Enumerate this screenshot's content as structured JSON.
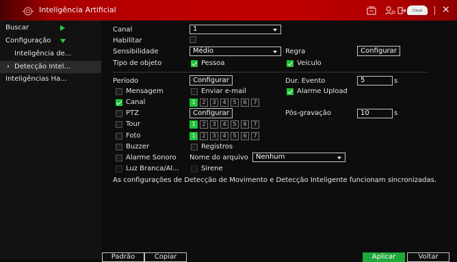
{
  "window": {
    "title": "Inteligência Artificial"
  },
  "titlebar": {
    "cloud_label": "Cloud",
    "close_label": "×"
  },
  "sidebar": {
    "items": [
      {
        "label": "Buscar"
      },
      {
        "label": "Configuração"
      },
      {
        "label": "Inteligência de..."
      },
      {
        "label": "Detecção Intel...",
        "prefix": "›"
      },
      {
        "label": "Inteligências Ha..."
      }
    ]
  },
  "form": {
    "canal_label": "Canal",
    "canal_value": "1",
    "habilitar_label": "Habilitar",
    "sensibilidade_label": "Sensibilidade",
    "sensibilidade_value": "Médio",
    "regra_label": "Regra",
    "regra_button": "Configurar",
    "tipo_objeto_label": "Tipo de objeto",
    "pessoa_label": "Pessoa",
    "veiculo_label": "Veículo",
    "periodo_label": "Período",
    "periodo_button": "Configurar",
    "dur_evento_label": "Dur. Evento",
    "dur_evento_value": "5",
    "dur_evento_unit": "s",
    "mensagem_label": "Mensagem",
    "enviar_email_label": "Enviar e-mail",
    "alarme_upload_label": "Alarme Upload",
    "canal_chk_label": "Canal",
    "ptz_label": "PTZ",
    "ptz_button": "Configurar",
    "pos_gravacao_label": "Pós-gravação",
    "pos_gravacao_value": "10",
    "pos_gravacao_unit": "s",
    "tour_label": "Tour",
    "foto_label": "Foto",
    "buzzer_label": "Buzzer",
    "registros_label": "Registros",
    "alarme_sonoro_label": "Alarme Sonoro",
    "nome_arquivo_label": "Nome do arquivo",
    "nome_arquivo_value": "Nenhum",
    "luz_branca_label": "Luz Branca/Al...",
    "sirene_label": "Sirene",
    "info": "As configurações de Detecção de Movimento e Detecção Inteligente funcionam sincronizadas.",
    "channels": [
      "1",
      "2",
      "3",
      "4",
      "5",
      "6",
      "7"
    ]
  },
  "footer": {
    "padrao": "Padrão",
    "copiar": "Copiar",
    "aplicar": "Aplicar",
    "voltar": "Voltar"
  },
  "colors": {
    "accent": "#21c23a",
    "titlebar": "#b80000"
  }
}
